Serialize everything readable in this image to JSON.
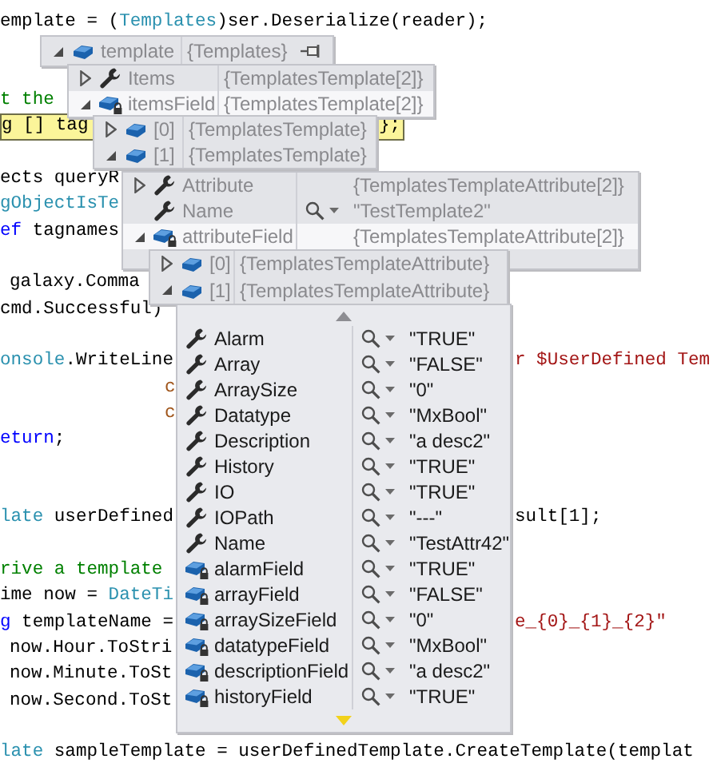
{
  "code_lines": [
    {
      "kind": "code",
      "current": false,
      "parts": [
        {
          "text": "emplate = (",
          "kind": "plain"
        },
        {
          "text": "Templates",
          "kind": "type"
        },
        {
          "text": ")ser.Deserialize(reader);",
          "kind": "plain"
        }
      ]
    },
    {
      "kind": "blank"
    },
    {
      "kind": "blank"
    },
    {
      "kind": "code",
      "current": false,
      "parts": [
        {
          "text": "t the",
          "kind": "comment"
        }
      ]
    },
    {
      "kind": "code",
      "current": true,
      "parts": [
        {
          "text": "g [] tag",
          "kind": "plain"
        }
      ],
      "tail": [
        {
          "text": "};",
          "kind": "plain"
        }
      ]
    },
    {
      "kind": "blank"
    },
    {
      "kind": "code",
      "current": false,
      "parts": [
        {
          "text": "ects queryR",
          "kind": "plain"
        }
      ]
    },
    {
      "kind": "code",
      "current": false,
      "parts": [
        {
          "text": "gObjectIsTe",
          "kind": "type"
        }
      ]
    },
    {
      "kind": "code",
      "current": false,
      "parts": [
        {
          "text": "ef",
          "kind": "keyword"
        },
        {
          "text": " tagnames",
          "kind": "plain"
        }
      ]
    },
    {
      "kind": "blank"
    },
    {
      "kind": "code",
      "current": false,
      "parts": [
        {
          "text": "galaxy.Comma",
          "kind": "plain"
        }
      ]
    },
    {
      "kind": "code",
      "current": false,
      "parts": [
        {
          "text": "cmd.Successful)",
          "kind": "plain"
        }
      ]
    },
    {
      "kind": "blank"
    },
    {
      "kind": "code",
      "current": false,
      "parts": [
        {
          "text": "onsole",
          "kind": "type"
        },
        {
          "text": ".WriteLine",
          "kind": "plain"
        }
      ],
      "tail": [
        {
          "text": "r $UserDefined Tem",
          "kind": "string"
        }
      ]
    },
    {
      "kind": "code",
      "current": false,
      "parts": [
        {
          "text": "c",
          "kind": "local"
        }
      ]
    },
    {
      "kind": "code",
      "current": false,
      "parts": [
        {
          "text": "c",
          "kind": "local"
        }
      ]
    },
    {
      "kind": "code",
      "current": false,
      "parts": [
        {
          "text": "eturn",
          "kind": "keyword"
        },
        {
          "text": ";",
          "kind": "plain"
        }
      ]
    },
    {
      "kind": "blank"
    },
    {
      "kind": "blank"
    },
    {
      "kind": "code",
      "current": false,
      "parts": [
        {
          "text": "late",
          "kind": "type"
        },
        {
          "text": " userDefined",
          "kind": "plain"
        }
      ],
      "tail": [
        {
          "text": "sult[1];",
          "kind": "plain"
        }
      ]
    },
    {
      "kind": "blank"
    },
    {
      "kind": "code",
      "current": false,
      "parts": [
        {
          "text": "rive a template",
          "kind": "comment"
        }
      ]
    },
    {
      "kind": "code",
      "current": false,
      "parts": [
        {
          "text": "ime now = ",
          "kind": "plain"
        },
        {
          "text": "DateTi",
          "kind": "type"
        }
      ]
    },
    {
      "kind": "code",
      "current": false,
      "parts": [
        {
          "text": "g",
          "kind": "keyword"
        },
        {
          "text": " templateName =",
          "kind": "plain"
        }
      ],
      "tail": [
        {
          "text": "e_{0}_{1}_{2}\"",
          "kind": "string"
        }
      ]
    },
    {
      "kind": "code",
      "current": false,
      "parts": [
        {
          "text": "now.Hour.ToStri",
          "kind": "plain"
        }
      ]
    },
    {
      "kind": "code",
      "current": false,
      "parts": [
        {
          "text": "now.Minute.ToSt",
          "kind": "plain"
        }
      ]
    },
    {
      "kind": "code",
      "current": false,
      "parts": [
        {
          "text": "now.Second.ToSt",
          "kind": "plain"
        }
      ]
    },
    {
      "kind": "blank"
    },
    {
      "kind": "code",
      "current": false,
      "parts": [
        {
          "text": "late",
          "kind": "type"
        },
        {
          "text": " sampleTemplate = userDefinedTemplate.CreateTemplate(templat",
          "kind": "plain"
        }
      ]
    }
  ],
  "datatips": [
    {
      "faded": true,
      "pin": true,
      "rows": [
        {
          "kind": "object",
          "name": "template",
          "value": "{Templates}",
          "expanded": true,
          "selected": false
        }
      ]
    },
    {
      "faded": true,
      "rows": [
        {
          "kind": "property",
          "name": "Items",
          "value": "{TemplatesTemplate[2]}",
          "expanded": false,
          "selected": false
        },
        {
          "kind": "field",
          "name": "itemsField",
          "value": "{TemplatesTemplate[2]}",
          "expanded": true,
          "selected": true
        }
      ]
    },
    {
      "faded": true,
      "rows": [
        {
          "kind": "object",
          "name": "[0]",
          "value": "{TemplatesTemplate}",
          "expanded": false,
          "selected": false
        },
        {
          "kind": "object",
          "name": "[1]",
          "value": "{TemplatesTemplate}",
          "expanded": true,
          "selected": false
        }
      ]
    },
    {
      "faded": true,
      "rows": [
        {
          "kind": "property",
          "name": "Attribute",
          "value": "{TemplatesTemplateAttribute[2]}",
          "expanded": false,
          "selected": false
        },
        {
          "kind": "property",
          "name": "Name",
          "value": "\"TestTemplate2\"",
          "visualizer": true,
          "selected": false
        },
        {
          "kind": "field",
          "name": "attributeField",
          "value": "{TemplatesTemplateAttribute[2]}",
          "expanded": true,
          "selected": true
        }
      ]
    },
    {
      "faded": true,
      "rows": [
        {
          "kind": "object",
          "name": "[0]",
          "value": "{TemplatesTemplateAttribute}",
          "expanded": false,
          "selected": false
        },
        {
          "kind": "object",
          "name": "[1]",
          "value": "{TemplatesTemplateAttribute}",
          "expanded": true,
          "selected": false
        }
      ]
    },
    {
      "faded": false,
      "scrollable": true,
      "rows": [
        {
          "kind": "property",
          "name": "Alarm",
          "value": "\"TRUE\"",
          "visualizer": true,
          "selected": false
        },
        {
          "kind": "property",
          "name": "Array",
          "value": "\"FALSE\"",
          "visualizer": true,
          "selected": false
        },
        {
          "kind": "property",
          "name": "ArraySize",
          "value": "\"0\"",
          "visualizer": true,
          "selected": false
        },
        {
          "kind": "property",
          "name": "Datatype",
          "value": "\"MxBool\"",
          "visualizer": true,
          "selected": false
        },
        {
          "kind": "property",
          "name": "Description",
          "value": "\"a desc2\"",
          "visualizer": true,
          "selected": false
        },
        {
          "kind": "property",
          "name": "History",
          "value": "\"TRUE\"",
          "visualizer": true,
          "selected": false
        },
        {
          "kind": "property",
          "name": "IO",
          "value": "\"TRUE\"",
          "visualizer": true,
          "selected": false
        },
        {
          "kind": "property",
          "name": "IOPath",
          "value": "\"---\"",
          "visualizer": true,
          "selected": false
        },
        {
          "kind": "property",
          "name": "Name",
          "value": "\"TestAttr42\"",
          "visualizer": true,
          "selected": false
        },
        {
          "kind": "field",
          "name": "alarmField",
          "value": "\"TRUE\"",
          "visualizer": true,
          "selected": false
        },
        {
          "kind": "field",
          "name": "arrayField",
          "value": "\"FALSE\"",
          "visualizer": true,
          "selected": false
        },
        {
          "kind": "field",
          "name": "arraySizeField",
          "value": "\"0\"",
          "visualizer": true,
          "selected": false
        },
        {
          "kind": "field",
          "name": "datatypeField",
          "value": "\"MxBool\"",
          "visualizer": true,
          "selected": false
        },
        {
          "kind": "field",
          "name": "descriptionField",
          "value": "\"a desc2\"",
          "visualizer": true,
          "selected": false
        },
        {
          "kind": "field",
          "name": "historyField",
          "value": "\"TRUE\"",
          "visualizer": true,
          "selected": false
        }
      ]
    }
  ]
}
